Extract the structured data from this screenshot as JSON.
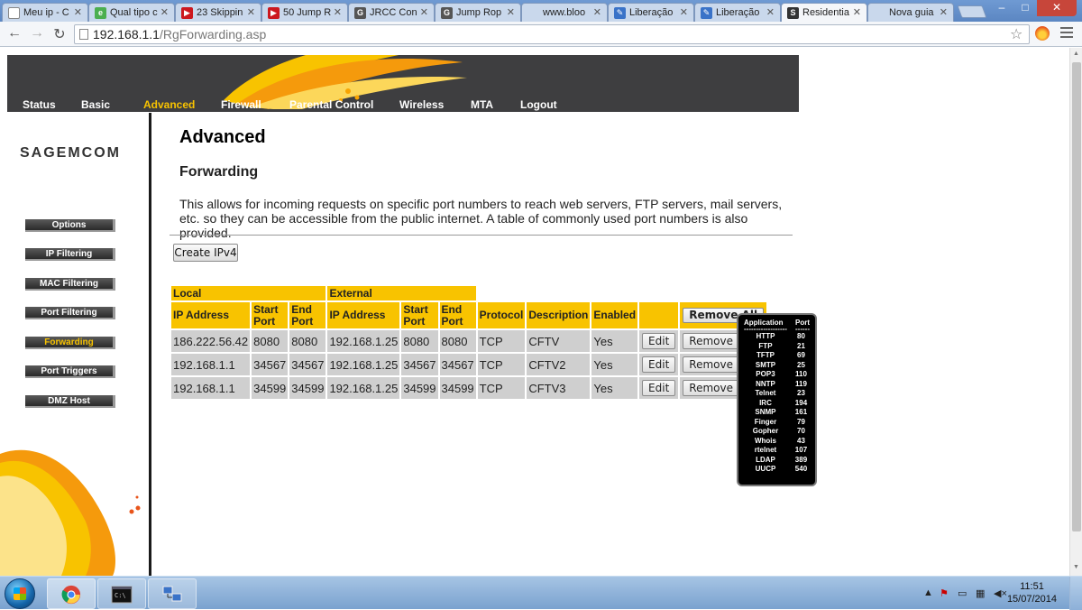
{
  "browser": {
    "tabs": [
      {
        "label": "Meu ip - C",
        "icon": "document-icon",
        "color": "#ffffff"
      },
      {
        "label": "Qual tipo c",
        "icon": "e-icon",
        "color": "#4caf50"
      },
      {
        "label": "23 Skippin",
        "icon": "youtube-icon",
        "color": "#cc181e"
      },
      {
        "label": "50 Jump R",
        "icon": "youtube-icon",
        "color": "#cc181e"
      },
      {
        "label": "JRCC Con",
        "icon": "g-icon",
        "color": "#555555"
      },
      {
        "label": "Jump Rop",
        "icon": "g-icon",
        "color": "#555555"
      },
      {
        "label": "www.bloo",
        "icon": "blank-icon",
        "color": "#c9d8ec"
      },
      {
        "label": "Liberação",
        "icon": "pen-icon",
        "color": "#3a73c8"
      },
      {
        "label": "Liberação",
        "icon": "pen-icon",
        "color": "#3a73c8"
      },
      {
        "label": "Residentia",
        "icon": "s-icon",
        "color": "#333333"
      },
      {
        "label": "Nova guia",
        "icon": "blank-icon",
        "color": "#c9d8ec"
      }
    ],
    "active_tab": 9,
    "url_host": "192.168.1.1",
    "url_path": "/RgForwarding.asp"
  },
  "router": {
    "nav": [
      "Status",
      "Basic",
      "Advanced",
      "Firewall",
      "Parental Control",
      "Wireless",
      "MTA",
      "Logout"
    ],
    "active_nav": 2,
    "logo": "SAGEMCOM",
    "side": [
      "Options",
      "IP Filtering",
      "MAC Filtering",
      "Port Filtering",
      "Forwarding",
      "Port Triggers",
      "DMZ Host"
    ],
    "active_side": 4,
    "title": "Advanced",
    "subtitle": "Forwarding",
    "description": "This allows for incoming requests on specific port numbers to reach web servers, FTP servers, mail servers, etc. so they can be accessible from the public internet. A table of commonly used port numbers is also provided.",
    "create_btn": "Create IPv4",
    "table": {
      "group_local": "Local",
      "group_external": "External",
      "headers": [
        "IP Address",
        "Start Port",
        "End Port",
        "IP Address",
        "Start Port",
        "End Port",
        "Protocol",
        "Description",
        "Enabled"
      ],
      "remove_all": "Remove All",
      "edit": "Edit",
      "remove": "Remove",
      "rows": [
        [
          "186.222.56.42",
          "8080",
          "8080",
          "192.168.1.25",
          "8080",
          "8080",
          "TCP",
          "CFTV",
          "Yes"
        ],
        [
          "192.168.1.1",
          "34567",
          "34567",
          "192.168.1.25",
          "34567",
          "34567",
          "TCP",
          "CFTV2",
          "Yes"
        ],
        [
          "192.168.1.1",
          "34599",
          "34599",
          "192.168.1.25",
          "34599",
          "34599",
          "TCP",
          "CFTV3",
          "Yes"
        ]
      ]
    },
    "ports": {
      "head_app": "Application",
      "head_port": "Port",
      "sep": "------------------",
      "sep2": "------",
      "list": [
        [
          "HTTP",
          "80"
        ],
        [
          "FTP",
          "21"
        ],
        [
          "TFTP",
          "69"
        ],
        [
          "SMTP",
          "25"
        ],
        [
          "POP3",
          "110"
        ],
        [
          "NNTP",
          "119"
        ],
        [
          "Telnet",
          "23"
        ],
        [
          "IRC",
          "194"
        ],
        [
          "SNMP",
          "161"
        ],
        [
          "Finger",
          "79"
        ],
        [
          "Gopher",
          "70"
        ],
        [
          "Whois",
          "43"
        ],
        [
          "rtelnet",
          "107"
        ],
        [
          "LDAP",
          "389"
        ],
        [
          "UUCP",
          "540"
        ]
      ]
    },
    "accent": "#f8c300"
  },
  "taskbar": {
    "time": "11:51",
    "date": "15/07/2014"
  }
}
